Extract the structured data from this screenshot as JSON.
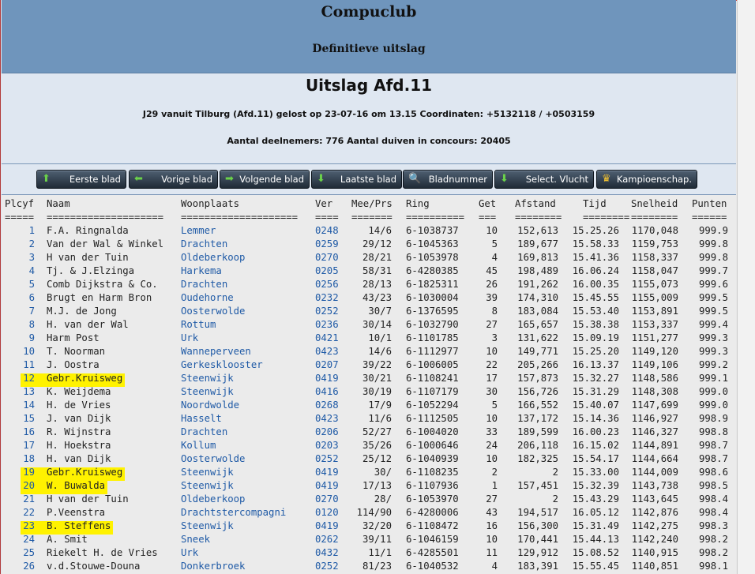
{
  "header": {
    "club": "Compuclub",
    "subtitle": "Definitieve uitslag"
  },
  "info": {
    "title": "Uitslag Afd.11",
    "flight_line": "J29 vanuit Tilburg (Afd.11) gelost op 23-07-16 om 13.15 Coordinaten: +5132118 / +0503159",
    "participants_line": "Aantal deelnemers: 776 Aantal duiven in concours: 20405"
  },
  "nav": [
    {
      "label": "Eerste blad",
      "icon": "arrow-up-icon",
      "glyph": "⬆"
    },
    {
      "label": "Vorige blad",
      "icon": "arrow-left-icon",
      "glyph": "⬅"
    },
    {
      "label": "Volgende blad",
      "icon": "arrow-right-icon",
      "glyph": "➡"
    },
    {
      "label": "Laatste blad",
      "icon": "arrow-down-icon",
      "glyph": "⬇"
    },
    {
      "label": "Bladnummer",
      "icon": "search-icon",
      "glyph": "🔍"
    },
    {
      "label": "Select. Vlucht",
      "icon": "download-icon",
      "glyph": "⬇"
    },
    {
      "label": "Kampioenschap.",
      "icon": "crown-icon",
      "glyph": "♛"
    }
  ],
  "columns": [
    "Plcyf",
    "Naam",
    "Woonplaats",
    "Ver",
    "Mee/Prs",
    "Ring",
    "Get",
    "Afstand",
    "Tijd",
    "Snelheid",
    "Punten"
  ],
  "separators": [
    "=====",
    "====================",
    "====================",
    "====",
    "=======",
    "==========",
    "===",
    "========",
    "========",
    "========",
    "======"
  ],
  "rows": [
    {
      "p": "1",
      "naam": "F.A. Ringnalda",
      "plaats": "Lemmer",
      "ver": "0248",
      "mee": "14/6",
      "ring": "6-1038737",
      "get": "10",
      "afstand": "152,613",
      "tijd": "15.25.26",
      "snelheid": "1170,048",
      "punten": "999.9",
      "hl": false
    },
    {
      "p": "2",
      "naam": "Van der Wal & Winkel",
      "plaats": "Drachten",
      "ver": "0259",
      "mee": "29/12",
      "ring": "6-1045363",
      "get": "5",
      "afstand": "189,677",
      "tijd": "15.58.33",
      "snelheid": "1159,753",
      "punten": "999.8",
      "hl": false
    },
    {
      "p": "3",
      "naam": "H van der Tuin",
      "plaats": "Oldeberkoop",
      "ver": "0270",
      "mee": "28/21",
      "ring": "6-1053978",
      "get": "4",
      "afstand": "169,813",
      "tijd": "15.41.36",
      "snelheid": "1158,337",
      "punten": "999.8",
      "hl": false
    },
    {
      "p": "4",
      "naam": "Tj. & J.Elzinga",
      "plaats": "Harkema",
      "ver": "0205",
      "mee": "58/31",
      "ring": "6-4280385",
      "get": "45",
      "afstand": "198,489",
      "tijd": "16.06.24",
      "snelheid": "1158,047",
      "punten": "999.7",
      "hl": false
    },
    {
      "p": "5",
      "naam": "Comb Dijkstra & Co.",
      "plaats": "Drachten",
      "ver": "0256",
      "mee": "28/13",
      "ring": "6-1825311",
      "get": "26",
      "afstand": "191,262",
      "tijd": "16.00.35",
      "snelheid": "1155,073",
      "punten": "999.6",
      "hl": false
    },
    {
      "p": "6",
      "naam": "Brugt en Harm Bron",
      "plaats": "Oudehorne",
      "ver": "0232",
      "mee": "43/23",
      "ring": "6-1030004",
      "get": "39",
      "afstand": "174,310",
      "tijd": "15.45.55",
      "snelheid": "1155,009",
      "punten": "999.5",
      "hl": false
    },
    {
      "p": "7",
      "naam": "M.J. de Jong",
      "plaats": "Oosterwolde",
      "ver": "0252",
      "mee": "30/7",
      "ring": "6-1376595",
      "get": "8",
      "afstand": "183,084",
      "tijd": "15.53.40",
      "snelheid": "1153,891",
      "punten": "999.5",
      "hl": false
    },
    {
      "p": "8",
      "naam": "H. van der Wal",
      "plaats": "Rottum",
      "ver": "0236",
      "mee": "30/14",
      "ring": "6-1032790",
      "get": "27",
      "afstand": "165,657",
      "tijd": "15.38.38",
      "snelheid": "1153,337",
      "punten": "999.4",
      "hl": false
    },
    {
      "p": "9",
      "naam": "Harm Post",
      "plaats": "Urk",
      "ver": "0421",
      "mee": "10/1",
      "ring": "6-1101785",
      "get": "3",
      "afstand": "131,622",
      "tijd": "15.09.19",
      "snelheid": "1151,277",
      "punten": "999.3",
      "hl": false
    },
    {
      "p": "10",
      "naam": "T. Noorman",
      "plaats": "Wanneperveen",
      "ver": "0423",
      "mee": "14/6",
      "ring": "6-1112977",
      "get": "10",
      "afstand": "149,771",
      "tijd": "15.25.20",
      "snelheid": "1149,120",
      "punten": "999.3",
      "hl": false
    },
    {
      "p": "11",
      "naam": "J. Oostra",
      "plaats": "Gerkesklooster",
      "ver": "0207",
      "mee": "39/22",
      "ring": "6-1006005",
      "get": "22",
      "afstand": "205,266",
      "tijd": "16.13.37",
      "snelheid": "1149,106",
      "punten": "999.2",
      "hl": false
    },
    {
      "p": "12",
      "naam": "Gebr.Kruisweg",
      "plaats": "Steenwijk",
      "ver": "0419",
      "mee": "30/21",
      "ring": "6-1108241",
      "get": "17",
      "afstand": "157,873",
      "tijd": "15.32.27",
      "snelheid": "1148,586",
      "punten": "999.1",
      "hl": true
    },
    {
      "p": "13",
      "naam": "K. Weijdema",
      "plaats": "Steenwijk",
      "ver": "0416",
      "mee": "30/19",
      "ring": "6-1107179",
      "get": "30",
      "afstand": "156,726",
      "tijd": "15.31.29",
      "snelheid": "1148,308",
      "punten": "999.0",
      "hl": false
    },
    {
      "p": "14",
      "naam": "H. de Vries",
      "plaats": "Noordwolde",
      "ver": "0268",
      "mee": "17/9",
      "ring": "6-1052294",
      "get": "5",
      "afstand": "166,552",
      "tijd": "15.40.07",
      "snelheid": "1147,699",
      "punten": "999.0",
      "hl": false
    },
    {
      "p": "15",
      "naam": "J. van Dijk",
      "plaats": "Hasselt",
      "ver": "0423",
      "mee": "11/6",
      "ring": "6-1112505",
      "get": "10",
      "afstand": "137,172",
      "tijd": "15.14.36",
      "snelheid": "1146,927",
      "punten": "998.9",
      "hl": false
    },
    {
      "p": "16",
      "naam": "R. Wijnstra",
      "plaats": "Drachten",
      "ver": "0206",
      "mee": "52/27",
      "ring": "6-1004020",
      "get": "33",
      "afstand": "189,599",
      "tijd": "16.00.23",
      "snelheid": "1146,327",
      "punten": "998.8",
      "hl": false
    },
    {
      "p": "17",
      "naam": "H. Hoekstra",
      "plaats": "Kollum",
      "ver": "0203",
      "mee": "35/26",
      "ring": "6-1000646",
      "get": "24",
      "afstand": "206,118",
      "tijd": "16.15.02",
      "snelheid": "1144,891",
      "punten": "998.7",
      "hl": false
    },
    {
      "p": "18",
      "naam": "H. van Dijk",
      "plaats": "Oosterwolde",
      "ver": "0252",
      "mee": "25/12",
      "ring": "6-1040939",
      "get": "10",
      "afstand": "182,325",
      "tijd": "15.54.17",
      "snelheid": "1144,664",
      "punten": "998.7",
      "hl": false
    },
    {
      "p": "19",
      "naam": "Gebr.Kruisweg",
      "plaats": "Steenwijk",
      "ver": "0419",
      "mee": "30/",
      "ring": "6-1108235",
      "get": "2",
      "afstand": "2",
      "tijd": "15.33.00",
      "snelheid": "1144,009",
      "punten": "998.6",
      "hl": true
    },
    {
      "p": "20",
      "naam": "W. Buwalda",
      "plaats": "Steenwijk",
      "ver": "0419",
      "mee": "17/13",
      "ring": "6-1107936",
      "get": "1",
      "afstand": "157,451",
      "tijd": "15.32.39",
      "snelheid": "1143,738",
      "punten": "998.5",
      "hl": true
    },
    {
      "p": "21",
      "naam": "H van der Tuin",
      "plaats": "Oldeberkoop",
      "ver": "0270",
      "mee": "28/",
      "ring": "6-1053970",
      "get": "27",
      "afstand": "2",
      "tijd": "15.43.29",
      "snelheid": "1143,645",
      "punten": "998.4",
      "hl": false
    },
    {
      "p": "22",
      "naam": "P.Veenstra",
      "plaats": "Drachtstercompagni",
      "ver": "0120",
      "mee": "114/90",
      "ring": "6-4280006",
      "get": "43",
      "afstand": "194,517",
      "tijd": "16.05.12",
      "snelheid": "1142,876",
      "punten": "998.4",
      "hl": false
    },
    {
      "p": "23",
      "naam": "B. Steffens",
      "plaats": "Steenwijk",
      "ver": "0419",
      "mee": "32/20",
      "ring": "6-1108472",
      "get": "16",
      "afstand": "156,300",
      "tijd": "15.31.49",
      "snelheid": "1142,275",
      "punten": "998.3",
      "hl": true
    },
    {
      "p": "24",
      "naam": "A. Smit",
      "plaats": "Sneek",
      "ver": "0262",
      "mee": "39/11",
      "ring": "6-1046159",
      "get": "10",
      "afstand": "170,441",
      "tijd": "15.44.13",
      "snelheid": "1142,240",
      "punten": "998.2",
      "hl": false
    },
    {
      "p": "25",
      "naam": "Riekelt H. de Vries",
      "plaats": "Urk",
      "ver": "0432",
      "mee": "11/1",
      "ring": "6-4285501",
      "get": "11",
      "afstand": "129,912",
      "tijd": "15.08.52",
      "snelheid": "1140,915",
      "punten": "998.2",
      "hl": false
    },
    {
      "p": "26",
      "naam": "v.d.Stouwe-Douna",
      "plaats": "Donkerbroek",
      "ver": "0252",
      "mee": "81/23",
      "ring": "6-1040532",
      "get": "4",
      "afstand": "183,391",
      "tijd": "15.55.45",
      "snelheid": "1140,851",
      "punten": "998.1",
      "hl": false
    }
  ]
}
